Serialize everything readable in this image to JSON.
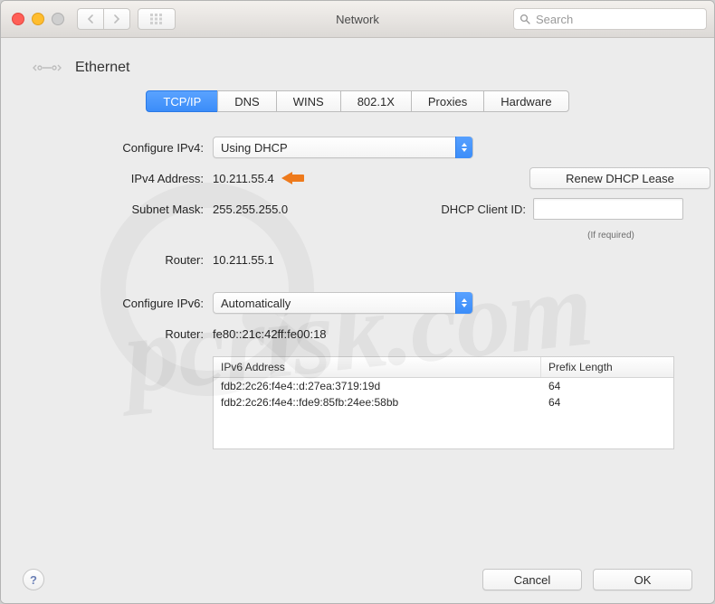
{
  "window": {
    "title": "Network"
  },
  "search": {
    "placeholder": "Search"
  },
  "header": {
    "interface": "Ethernet"
  },
  "tabs": {
    "items": [
      "TCP/IP",
      "DNS",
      "WINS",
      "802.1X",
      "Proxies",
      "Hardware"
    ],
    "selected_index": 0
  },
  "ipv4": {
    "configure_label": "Configure IPv4:",
    "configure_value": "Using DHCP",
    "address_label": "IPv4 Address:",
    "address_value": "10.211.55.4",
    "subnet_label": "Subnet Mask:",
    "subnet_value": "255.255.255.0",
    "router_label": "Router:",
    "router_value": "10.211.55.1"
  },
  "dhcp": {
    "renew_button": "Renew DHCP Lease",
    "client_id_label": "DHCP Client ID:",
    "client_id_value": "",
    "if_required": "(If required)"
  },
  "ipv6": {
    "configure_label": "Configure IPv6:",
    "configure_value": "Automatically",
    "router_label": "Router:",
    "router_value": "fe80::21c:42ff:fe00:18",
    "table": {
      "headers": {
        "address": "IPv6 Address",
        "prefix": "Prefix Length"
      },
      "rows": [
        {
          "address": "fdb2:2c26:f4e4::d:27ea:3719:19d",
          "prefix": "64"
        },
        {
          "address": "fdb2:2c26:f4e4::fde9:85fb:24ee:58bb",
          "prefix": "64"
        }
      ]
    }
  },
  "footer": {
    "help_glyph": "?",
    "cancel": "Cancel",
    "ok": "OK"
  }
}
